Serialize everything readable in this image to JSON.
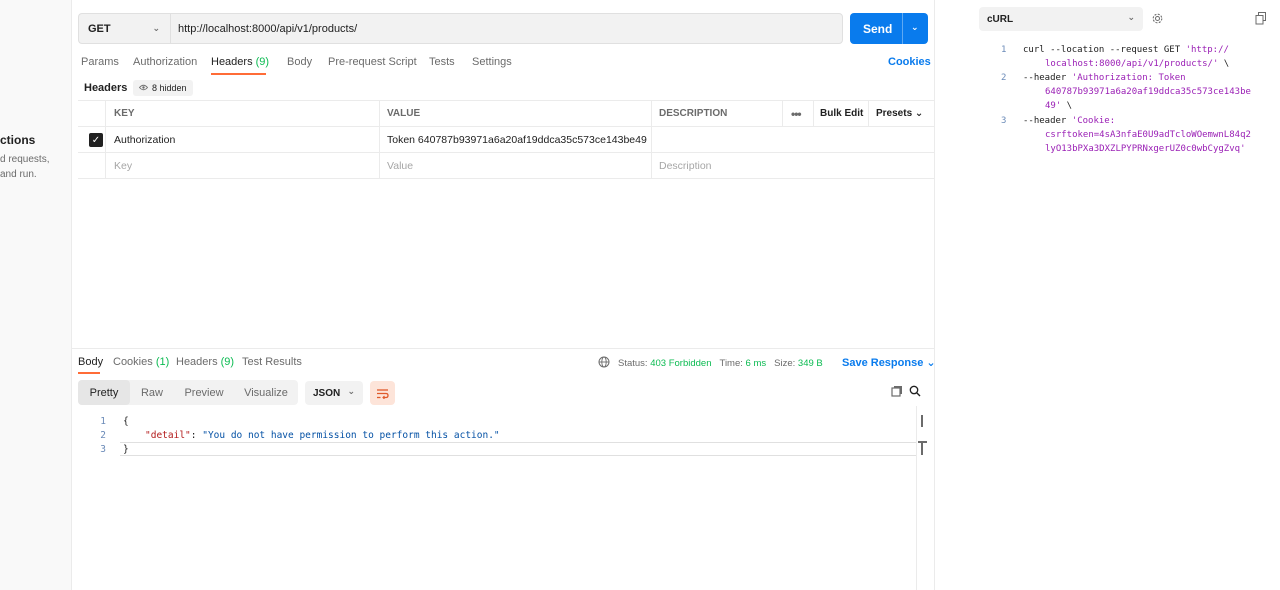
{
  "sidebar": {
    "title": "ctions",
    "desc1": "d requests,",
    "desc2": "and run."
  },
  "request": {
    "method": "GET",
    "url": "http://localhost:8000/api/v1/products/",
    "send_label": "Send"
  },
  "request_tabs": [
    {
      "label": "Params",
      "count": ""
    },
    {
      "label": "Authorization",
      "count": ""
    },
    {
      "label": "Headers",
      "count": "(9)"
    },
    {
      "label": "Body",
      "count": ""
    },
    {
      "label": "Pre-request Script",
      "count": ""
    },
    {
      "label": "Tests",
      "count": ""
    },
    {
      "label": "Settings",
      "count": ""
    }
  ],
  "cookies_label": "Cookies",
  "headers_section": {
    "title": "Headers",
    "hidden": "8 hidden"
  },
  "headers_table": {
    "columns": {
      "key": "KEY",
      "value": "VALUE",
      "description": "DESCRIPTION",
      "bulk_edit": "Bulk Edit",
      "presets": "Presets"
    },
    "rows": [
      {
        "key": "Authorization",
        "value": "Token 640787b93971a6a20af19ddca35c573ce143be49",
        "description": ""
      }
    ],
    "placeholders": {
      "key": "Key",
      "value": "Value",
      "description": "Description"
    }
  },
  "response_tabs": [
    {
      "label": "Body",
      "count": ""
    },
    {
      "label": "Cookies",
      "count": "(1)"
    },
    {
      "label": "Headers",
      "count": "(9)"
    },
    {
      "label": "Test Results",
      "count": ""
    }
  ],
  "response_status": {
    "status_label": "Status:",
    "status": "403 Forbidden",
    "time_label": "Time:",
    "time": "6 ms",
    "size_label": "Size:",
    "size": "349 B",
    "save_label": "Save Response"
  },
  "view_modes": [
    "Pretty",
    "Raw",
    "Preview",
    "Visualize"
  ],
  "format": "JSON",
  "response_body": {
    "line1": "{",
    "key": "\"detail\"",
    "sep": ": ",
    "value": "\"You do not have permission to perform this action.\"",
    "line3": "}"
  },
  "snippet": {
    "language": "cURL",
    "lines": [
      {
        "n": "1",
        "a": "curl --location --request GET ",
        "b": "'http://"
      },
      {
        "n": "",
        "a": "",
        "b": "localhost:8000/api/v1/products/'",
        "c": " \\"
      },
      {
        "n": "2",
        "a": "--header ",
        "b": "'Authorization: Token"
      },
      {
        "n": "",
        "a": "",
        "b": "640787b93971a6a20af19ddca35c573ce143be"
      },
      {
        "n": "",
        "a": "",
        "b": "49'",
        "c": " \\"
      },
      {
        "n": "3",
        "a": "--header ",
        "b": "'Cookie:"
      },
      {
        "n": "",
        "a": "",
        "b": "csrftoken=4sA3nfaE0U9adTcloWOemwnL84q2"
      },
      {
        "n": "",
        "a": "",
        "b": "lyO13bPXa3DXZLPYPRNxgerUZ0c0wbCygZvq'"
      }
    ]
  }
}
